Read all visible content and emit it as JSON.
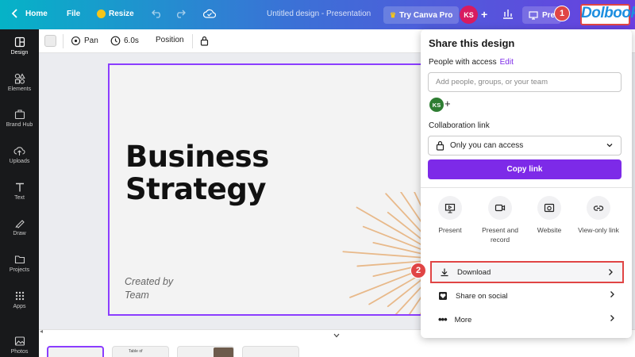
{
  "topbar": {
    "home_label": "Home",
    "file_label": "File",
    "resize_label": "Resize",
    "doc_title": "Untitled design - Presentation",
    "try_pro_label": "Try Canva Pro",
    "avatar_initials": "KS",
    "present_label": "Pre",
    "step1": "1",
    "watermark": "Dolbook"
  },
  "sidebar": {
    "items": [
      {
        "label": "Design",
        "icon": "layout-icon"
      },
      {
        "label": "Elements",
        "icon": "shapes-icon"
      },
      {
        "label": "Brand Hub",
        "icon": "briefcase-icon"
      },
      {
        "label": "Uploads",
        "icon": "cloud-upload-icon"
      },
      {
        "label": "Text",
        "icon": "text-icon"
      },
      {
        "label": "Draw",
        "icon": "pen-icon"
      },
      {
        "label": "Projects",
        "icon": "folder-icon"
      },
      {
        "label": "Apps",
        "icon": "grid-icon"
      },
      {
        "label": "Photos",
        "icon": "image-icon"
      }
    ]
  },
  "toolbar": {
    "pan_label": "Pan",
    "duration_label": "6.0s",
    "position_label": "Position"
  },
  "slide": {
    "title_line1": "Business",
    "title_line2": "Strategy",
    "subtitle_line1": "Created by",
    "subtitle_line2": "Team"
  },
  "thumbnails": {
    "thumb2_text": "Table of"
  },
  "share_panel": {
    "title": "Share this design",
    "people_label": "People with access",
    "edit_label": "Edit",
    "people_placeholder": "Add people, groups, or your team",
    "avatar_initials": "KS",
    "collab_label": "Collaboration link",
    "access_value": "Only you can access",
    "copy_link_label": "Copy link",
    "actions": [
      {
        "label": "Present",
        "icon": "present-icon"
      },
      {
        "label": "Present and record",
        "icon": "video-camera-icon"
      },
      {
        "label": "Website",
        "icon": "website-icon"
      },
      {
        "label": "View-only link",
        "icon": "link-icon"
      }
    ],
    "download_label": "Download",
    "share_social_label": "Share on social",
    "more_label": "More",
    "step2": "2"
  },
  "colors": {
    "accent": "#7d2ae8",
    "highlight": "#e04545",
    "sidebar_bg": "#18191b"
  }
}
